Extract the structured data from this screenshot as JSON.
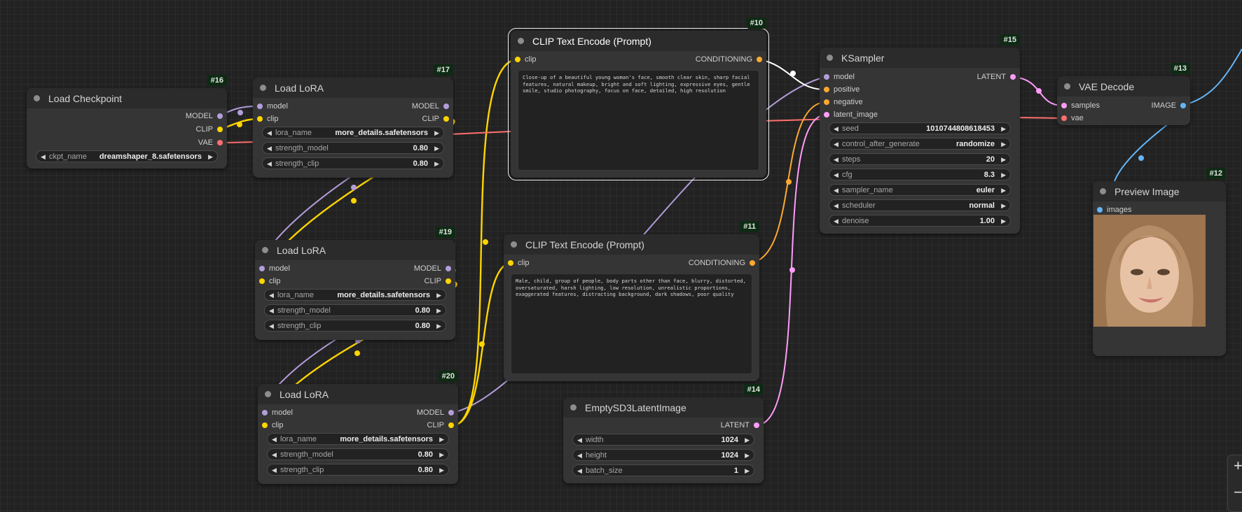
{
  "nodes": {
    "ckpt": {
      "id": "#16",
      "title": "Load Checkpoint",
      "outputs": [
        "MODEL",
        "CLIP",
        "VAE"
      ],
      "widgets": [
        {
          "name": "ckpt_name",
          "value": "dreamshaper_8.safetensors"
        }
      ]
    },
    "lora17": {
      "id": "#17",
      "title": "Load LoRA",
      "inputs": [
        "model",
        "clip"
      ],
      "outputs": [
        "MODEL",
        "CLIP"
      ],
      "widgets": [
        {
          "name": "lora_name",
          "value": "more_details.safetensors"
        },
        {
          "name": "strength_model",
          "value": "0.80"
        },
        {
          "name": "strength_clip",
          "value": "0.80"
        }
      ]
    },
    "lora19": {
      "id": "#19",
      "title": "Load LoRA",
      "inputs": [
        "model",
        "clip"
      ],
      "outputs": [
        "MODEL",
        "CLIP"
      ],
      "widgets": [
        {
          "name": "lora_name",
          "value": "more_details.safetensors"
        },
        {
          "name": "strength_model",
          "value": "0.80"
        },
        {
          "name": "strength_clip",
          "value": "0.80"
        }
      ]
    },
    "lora20": {
      "id": "#20",
      "title": "Load LoRA",
      "inputs": [
        "model",
        "clip"
      ],
      "outputs": [
        "MODEL",
        "CLIP"
      ],
      "widgets": [
        {
          "name": "lora_name",
          "value": "more_details.safetensors"
        },
        {
          "name": "strength_model",
          "value": "0.80"
        },
        {
          "name": "strength_clip",
          "value": "0.80"
        }
      ]
    },
    "clip10": {
      "id": "#10",
      "title": "CLIP Text Encode (Prompt)",
      "inputs": [
        "clip"
      ],
      "outputs": [
        "CONDITIONING"
      ],
      "text": "Close-up of a beautiful young woman's face, smooth clear skin, sharp facial features, natural makeup, bright and soft lighting, expressive eyes, gentle smile, studio photography, focus on face, detailed, high resolution"
    },
    "clip11": {
      "id": "#11",
      "title": "CLIP Text Encode (Prompt)",
      "inputs": [
        "clip"
      ],
      "outputs": [
        "CONDITIONING"
      ],
      "text": "Male, child, group of people, body parts other than face, blurry, distorted, oversaturated, harsh lighting, low resolution, unrealistic proportions, exaggerated features, distracting background, dark shadows, poor quality"
    },
    "ksampler": {
      "id": "#15",
      "title": "KSampler",
      "inputs": [
        "model",
        "positive",
        "negative",
        "latent_image"
      ],
      "outputs": [
        "LATENT"
      ],
      "widgets": [
        {
          "name": "seed",
          "value": "1010744808618453"
        },
        {
          "name": "control_after_generate",
          "value": "randomize"
        },
        {
          "name": "steps",
          "value": "20"
        },
        {
          "name": "cfg",
          "value": "8.3"
        },
        {
          "name": "sampler_name",
          "value": "euler"
        },
        {
          "name": "scheduler",
          "value": "normal"
        },
        {
          "name": "denoise",
          "value": "1.00"
        }
      ]
    },
    "latent": {
      "id": "#14",
      "title": "EmptySD3LatentImage",
      "outputs": [
        "LATENT"
      ],
      "widgets": [
        {
          "name": "width",
          "value": "1024"
        },
        {
          "name": "height",
          "value": "1024"
        },
        {
          "name": "batch_size",
          "value": "1"
        }
      ]
    },
    "vae": {
      "id": "#13",
      "title": "VAE Decode",
      "inputs": [
        "samples",
        "vae"
      ],
      "outputs": [
        "IMAGE"
      ]
    },
    "preview": {
      "id": "#12",
      "title": "Preview Image",
      "inputs": [
        "images"
      ]
    }
  },
  "zoom": {
    "plus": "+",
    "minus": "−"
  },
  "colors": {
    "model": "#b39ddb",
    "clip": "#ffd500",
    "vae": "#ff6e6e",
    "conditioning": "#ffa931",
    "latent": "#ff9cf9",
    "image": "#64b5f6"
  }
}
